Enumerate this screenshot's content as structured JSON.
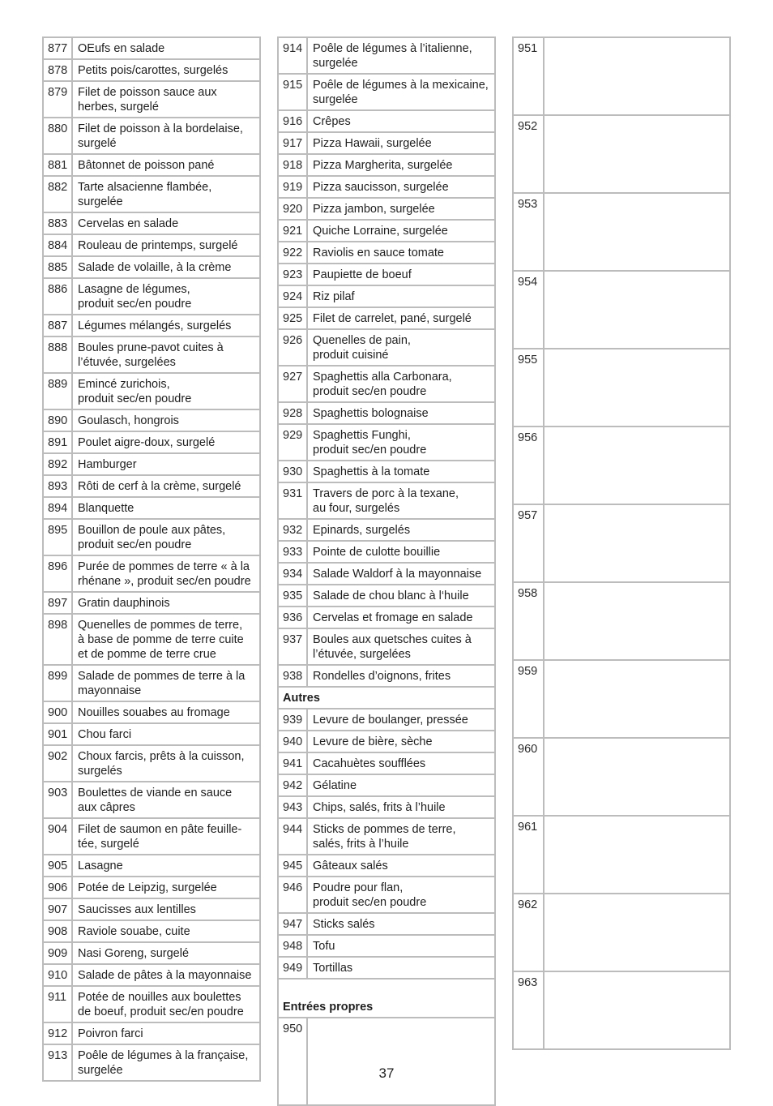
{
  "page_number": "37",
  "columns": {
    "left": [
      {
        "n": "877",
        "t": "OEufs en salade"
      },
      {
        "n": "878",
        "t": "Petits pois/carottes, surgelés"
      },
      {
        "n": "879",
        "t": "Filet de poisson sauce aux\nherbes, surgelé"
      },
      {
        "n": "880",
        "t": "Filet de poisson à la bordelaise,\nsurgelé"
      },
      {
        "n": "881",
        "t": "Bâtonnet de poisson pané"
      },
      {
        "n": "882",
        "t": "Tarte alsacienne flambée,\nsurgelée"
      },
      {
        "n": "883",
        "t": "Cervelas en salade"
      },
      {
        "n": "884",
        "t": "Rouleau de printemps, surgelé"
      },
      {
        "n": "885",
        "t": "Salade de volaille, à la crème"
      },
      {
        "n": "886",
        "t": "Lasagne de légumes,\nproduit sec/en poudre"
      },
      {
        "n": "887",
        "t": "Légumes mélangés, surgelés"
      },
      {
        "n": "888",
        "t": "Boules prune-pavot cuites à\nl’étuvée, surgelées"
      },
      {
        "n": "889",
        "t": "Emincé zurichois,\nproduit sec/en poudre"
      },
      {
        "n": "890",
        "t": "Goulasch, hongrois"
      },
      {
        "n": "891",
        "t": "Poulet aigre-doux, surgelé"
      },
      {
        "n": "892",
        "t": "Hamburger"
      },
      {
        "n": "893",
        "t": "Rôti de cerf à la crème, surgelé"
      },
      {
        "n": "894",
        "t": "Blanquette"
      },
      {
        "n": "895",
        "t": "Bouillon de poule aux pâtes,\nproduit sec/en poudre"
      },
      {
        "n": "896",
        "t": "Purée de pommes de terre « à la\nrhénane », produit sec/en poudre"
      },
      {
        "n": "897",
        "t": "Gratin dauphinois"
      },
      {
        "n": "898",
        "t": "Quenelles de pommes de terre,\nà base de pomme de terre cuite\net de pomme de terre crue"
      },
      {
        "n": "899",
        "t": "Salade de pommes de terre à la\nmayonnaise"
      },
      {
        "n": "900",
        "t": "Nouilles souabes au fromage"
      },
      {
        "n": "901",
        "t": "Chou farci"
      },
      {
        "n": "902",
        "t": "Choux farcis, prêts à la cuisson,\nsurgelés"
      },
      {
        "n": "903",
        "t": "Boulettes de viande en sauce\naux câpres"
      },
      {
        "n": "904",
        "t": "Filet de saumon en pâte feuille-\ntée, surgelé"
      },
      {
        "n": "905",
        "t": "Lasagne"
      },
      {
        "n": "906",
        "t": "Potée de Leipzig, surgelée"
      },
      {
        "n": "907",
        "t": "Saucisses aux lentilles"
      },
      {
        "n": "908",
        "t": "Raviole souabe, cuite"
      },
      {
        "n": "909",
        "t": "Nasi Goreng, surgelé"
      },
      {
        "n": "910",
        "t": "Salade de pâtes à la mayonnaise"
      },
      {
        "n": "911",
        "t": "Potée de nouilles aux boulettes\nde boeuf, produit sec/en poudre"
      },
      {
        "n": "912",
        "t": "Poivron farci"
      },
      {
        "n": "913",
        "t": "Poêle de légumes à la française,\nsurgelée"
      }
    ],
    "middle": [
      {
        "n": "914",
        "t": "Poêle de légumes à l’italienne,\nsurgelée"
      },
      {
        "n": "915",
        "t": "Poêle de légumes à la mexicaine,\nsurgelée"
      },
      {
        "n": "916",
        "t": "Crêpes"
      },
      {
        "n": "917",
        "t": "Pizza Hawaii, surgelée"
      },
      {
        "n": "918",
        "t": "Pizza Margherita, surgelée"
      },
      {
        "n": "919",
        "t": "Pizza saucisson, surgelée"
      },
      {
        "n": "920",
        "t": "Pizza jambon, surgelée"
      },
      {
        "n": "921",
        "t": "Quiche Lorraine, surgelée"
      },
      {
        "n": "922",
        "t": "Raviolis en sauce tomate"
      },
      {
        "n": "923",
        "t": "Paupiette de boeuf"
      },
      {
        "n": "924",
        "t": "Riz pilaf"
      },
      {
        "n": "925",
        "t": "Filet de carrelet, pané, surgelé"
      },
      {
        "n": "926",
        "t": "Quenelles de pain,\nproduit cuisiné"
      },
      {
        "n": "927",
        "t": "Spaghettis alla Carbonara,\nproduit sec/en poudre"
      },
      {
        "n": "928",
        "t": "Spaghettis bolognaise"
      },
      {
        "n": "929",
        "t": "Spaghettis Funghi,\nproduit sec/en poudre"
      },
      {
        "n": "930",
        "t": "Spaghettis à la tomate"
      },
      {
        "n": "931",
        "t": "Travers de porc à la texane,\nau four, surgelés"
      },
      {
        "n": "932",
        "t": "Epinards, surgelés"
      },
      {
        "n": "933",
        "t": "Pointe de culotte bouillie"
      },
      {
        "n": "934",
        "t": "Salade Waldorf à la mayonnaise"
      },
      {
        "n": "935",
        "t": "Salade de chou blanc à l‘huile"
      },
      {
        "n": "936",
        "t": "Cervelas et fromage en salade"
      },
      {
        "n": "937",
        "t": "Boules aux quetsches cuites à\nl’étuvée, surgelées"
      },
      {
        "n": "938",
        "t": "Rondelles d’oignons, frites"
      }
    ],
    "autres_heading": "Autres",
    "autres": [
      {
        "n": "939",
        "t": "Levure de boulanger, pressée"
      },
      {
        "n": "940",
        "t": "Levure de bière, sèche"
      },
      {
        "n": "941",
        "t": "Cacahuètes soufflées"
      },
      {
        "n": "942",
        "t": "Gélatine"
      },
      {
        "n": "943",
        "t": "Chips, salés, frits à l’huile"
      },
      {
        "n": "944",
        "t": "Sticks de pommes de terre,\nsalés, frits à l’huile"
      },
      {
        "n": "945",
        "t": "Gâteaux salés"
      },
      {
        "n": "946",
        "t": "Poudre pour flan,\nproduit sec/en poudre"
      },
      {
        "n": "947",
        "t": "Sticks salés"
      },
      {
        "n": "948",
        "t": "Tofu"
      },
      {
        "n": "949",
        "t": "Tortillas"
      }
    ],
    "custom_heading": "Entrées propres",
    "custom_middle": [
      {
        "n": "950",
        "t": ""
      }
    ],
    "right": [
      {
        "n": "951",
        "t": ""
      },
      {
        "n": "952",
        "t": ""
      },
      {
        "n": "953",
        "t": ""
      },
      {
        "n": "954",
        "t": ""
      },
      {
        "n": "955",
        "t": ""
      },
      {
        "n": "956",
        "t": ""
      },
      {
        "n": "957",
        "t": ""
      },
      {
        "n": "958",
        "t": ""
      },
      {
        "n": "959",
        "t": ""
      },
      {
        "n": "960",
        "t": ""
      },
      {
        "n": "961",
        "t": ""
      },
      {
        "n": "962",
        "t": ""
      },
      {
        "n": "963",
        "t": ""
      }
    ]
  }
}
